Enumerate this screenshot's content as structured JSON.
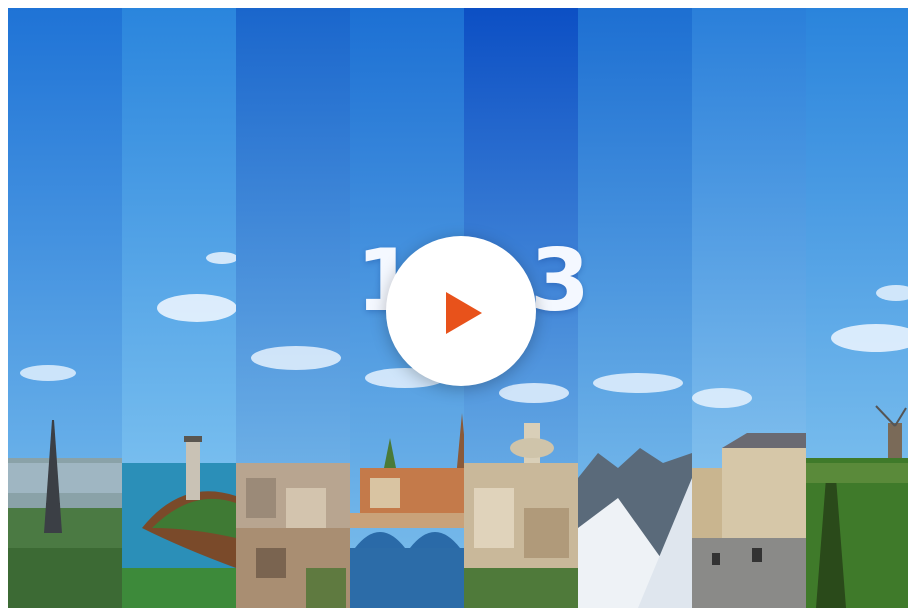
{
  "video": {
    "number_left": "1",
    "number_right": "3",
    "play_icon": "play-icon",
    "play_color": "#e8521b",
    "scenes": [
      {
        "name": "eiffel-tower-paris"
      },
      {
        "name": "lighthouse-brittany"
      },
      {
        "name": "city-rooftops"
      },
      {
        "name": "strasbourg-bridge"
      },
      {
        "name": "marseille-basilica"
      },
      {
        "name": "alpine-mountains"
      },
      {
        "name": "historic-town-square"
      },
      {
        "name": "vineyard-windmill"
      }
    ]
  }
}
